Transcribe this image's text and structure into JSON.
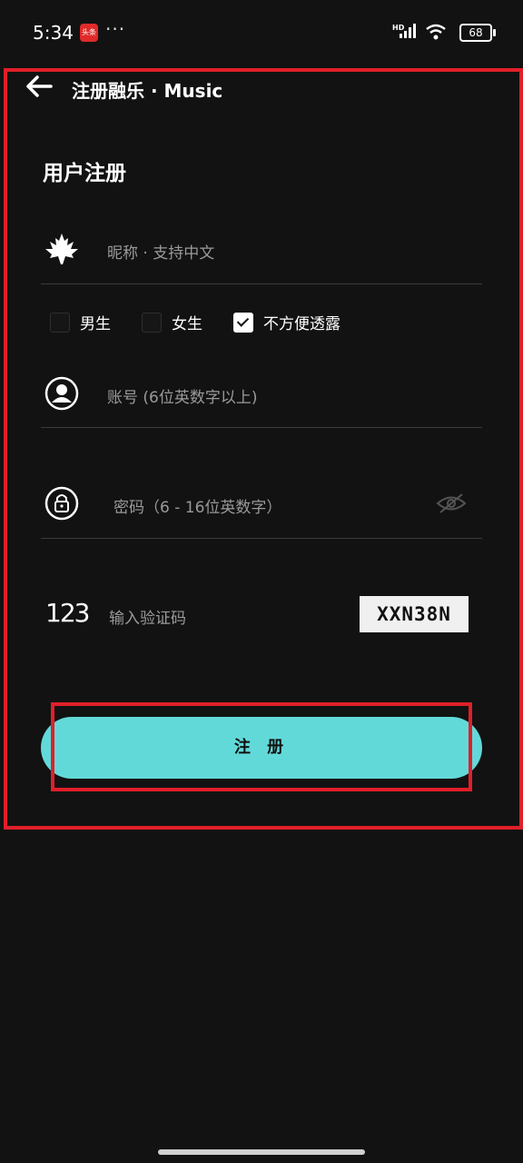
{
  "status_bar": {
    "time": "5:34",
    "app_badge": "头条",
    "more": "···",
    "network": "HD",
    "battery": "68"
  },
  "header": {
    "title": "注册融乐 · Music"
  },
  "form": {
    "section_title": "用户注册",
    "nickname_placeholder": "昵称 · 支持中文",
    "gender_options": [
      {
        "label": "男生",
        "checked": false
      },
      {
        "label": "女生",
        "checked": false
      },
      {
        "label": "不方便透露",
        "checked": true
      }
    ],
    "account_placeholder": "账号 (6位英数字以上)",
    "password_placeholder": "密码（6 - 16位英数字）",
    "captcha_icon_text": "123",
    "captcha_placeholder": "输入验证码",
    "captcha_code": "XXN38N",
    "register_label": "注 册"
  },
  "colors": {
    "background": "#121212",
    "accent": "#62d9d9",
    "highlight": "#e01f2a"
  }
}
